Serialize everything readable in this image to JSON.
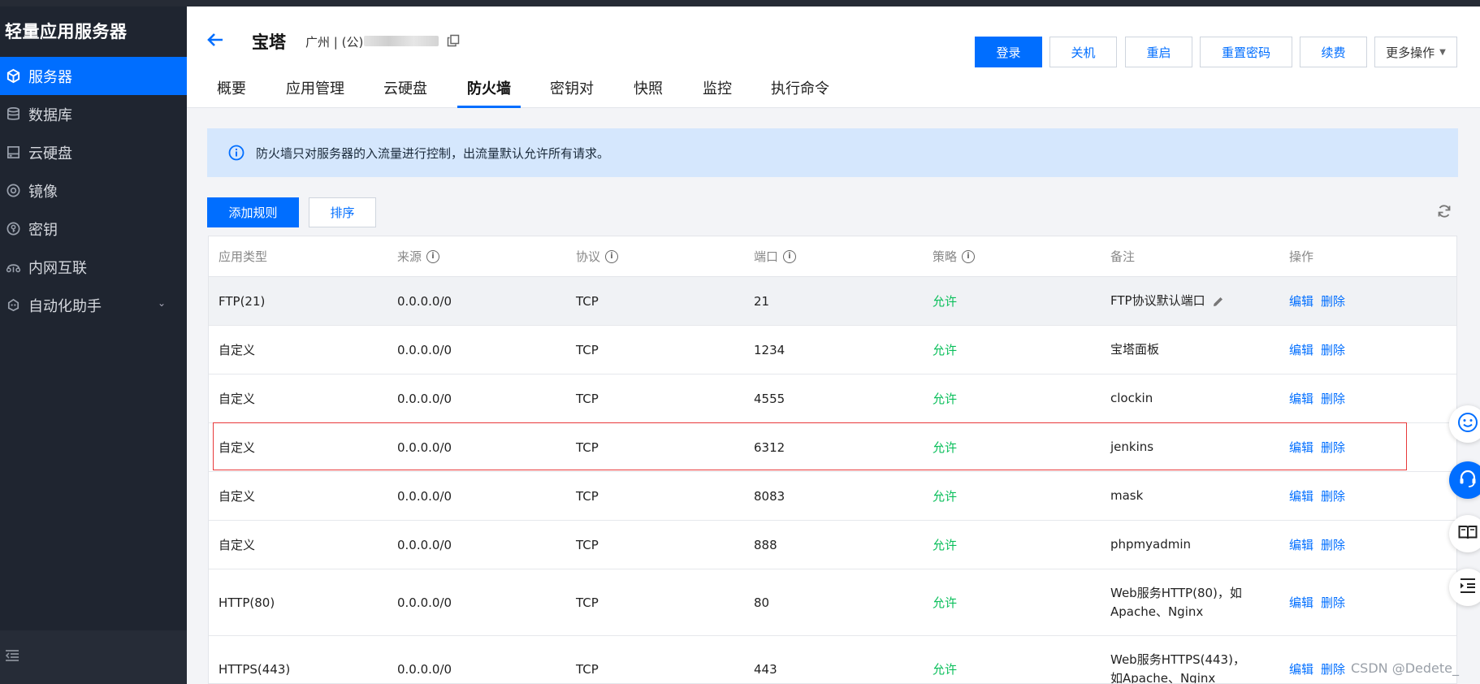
{
  "sidebar": {
    "brand": "轻量应用服务器",
    "items": [
      {
        "label": "服务器",
        "icon": "cube-icon",
        "active": true
      },
      {
        "label": "数据库",
        "icon": "database-icon"
      },
      {
        "label": "云硬盘",
        "icon": "disk-icon"
      },
      {
        "label": "镜像",
        "icon": "image-icon"
      },
      {
        "label": "密钥",
        "icon": "key-icon"
      },
      {
        "label": "内网互联",
        "icon": "network-icon"
      },
      {
        "label": "自动化助手",
        "icon": "robot-icon",
        "expandable": true
      }
    ]
  },
  "header": {
    "title": "宝塔",
    "region": "广州 | (公)",
    "buttons": {
      "login": "登录",
      "shutdown": "关机",
      "restart": "重启",
      "reset_password": "重置密码",
      "renew": "续费",
      "more": "更多操作"
    },
    "tabs": [
      "概要",
      "应用管理",
      "云硬盘",
      "防火墙",
      "密钥对",
      "快照",
      "监控",
      "执行命令"
    ],
    "active_tab": "防火墙"
  },
  "notice": "防火墙只对服务器的入流量进行控制，出流量默认允许所有请求。",
  "toolbar": {
    "add_rule": "添加规则",
    "sort": "排序"
  },
  "table": {
    "columns": [
      "应用类型",
      "来源",
      "协议",
      "端口",
      "策略",
      "备注",
      "操作"
    ],
    "rows": [
      {
        "type": "FTP(21)",
        "source": "0.0.0.0/0",
        "protocol": "TCP",
        "port": "21",
        "policy": "允许",
        "note": "FTP协议默认端口",
        "edit": "编辑",
        "delete": "删除"
      },
      {
        "type": "自定义",
        "source": "0.0.0.0/0",
        "protocol": "TCP",
        "port": "1234",
        "policy": "允许",
        "note": "宝塔面板",
        "edit": "编辑",
        "delete": "删除"
      },
      {
        "type": "自定义",
        "source": "0.0.0.0/0",
        "protocol": "TCP",
        "port": "4555",
        "policy": "允许",
        "note": "clockin",
        "edit": "编辑",
        "delete": "删除"
      },
      {
        "type": "自定义",
        "source": "0.0.0.0/0",
        "protocol": "TCP",
        "port": "6312",
        "policy": "允许",
        "note": "jenkins",
        "edit": "编辑",
        "delete": "删除"
      },
      {
        "type": "自定义",
        "source": "0.0.0.0/0",
        "protocol": "TCP",
        "port": "8083",
        "policy": "允许",
        "note": "mask",
        "edit": "编辑",
        "delete": "删除"
      },
      {
        "type": "自定义",
        "source": "0.0.0.0/0",
        "protocol": "TCP",
        "port": "888",
        "policy": "允许",
        "note": "phpmyadmin",
        "edit": "编辑",
        "delete": "删除"
      },
      {
        "type": "HTTP(80)",
        "source": "0.0.0.0/0",
        "protocol": "TCP",
        "port": "80",
        "policy": "允许",
        "note": "Web服务HTTP(80)，如Apache、Nginx",
        "edit": "编辑",
        "delete": "删除"
      },
      {
        "type": "HTTPS(443)",
        "source": "0.0.0.0/0",
        "protocol": "TCP",
        "port": "443",
        "policy": "允许",
        "note": "Web服务HTTPS(443)，如Apache、Nginx",
        "edit": "编辑",
        "delete": "删除"
      }
    ]
  },
  "watermark": "CSDN @Dedete_",
  "colors": {
    "accent": "#006eff",
    "allow": "#0abf5b",
    "sidebar_bg": "#1f2530",
    "notice_bg": "#d5e7fd",
    "highlight": "#e8393b"
  }
}
